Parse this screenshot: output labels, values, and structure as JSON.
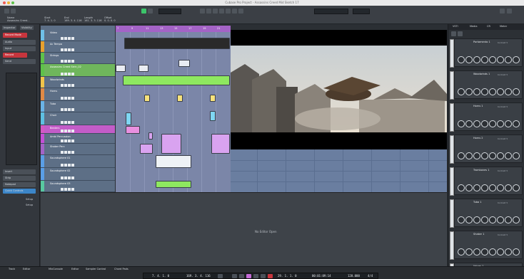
{
  "window": {
    "title": "Cubase Pro Project - Assassins Creed Mid Sketch 17"
  },
  "colors": {
    "accent_purple": "#a463c7",
    "accent_green": "#5fc24a",
    "record_red": "#c7353d",
    "arrange_bg": "#7b86a8"
  },
  "toolbar": {
    "fields": [
      {
        "label": "Name",
        "value": "Assassins Creed..."
      },
      {
        "label": "Start",
        "value": "7. 4. 1. 0"
      },
      {
        "label": "End",
        "value": "169. 3. 4. 116"
      },
      {
        "label": "Length",
        "value": "161. 3. 3. 116"
      },
      {
        "label": "Offset",
        "value": "0. 0. 0. 0"
      }
    ],
    "tool_icons": [
      "select-icon",
      "range-icon",
      "split-icon",
      "glue-icon",
      "erase-icon",
      "zoom-icon",
      "mute-icon",
      "draw-icon",
      "line-icon",
      "play-icon"
    ]
  },
  "left_panel": {
    "tabs": [
      "Inspector",
      "Visibility"
    ],
    "record_rows": [
      "Record Mode",
      "Record"
    ],
    "rows": [
      "Audio",
      "Input",
      "Send",
      "Insert",
      "Strip",
      "Notepad",
      "Quick Controls"
    ],
    "groups": [
      "Setup",
      "Setup"
    ]
  },
  "tracks": [
    {
      "name": "Video",
      "color": "#6fc0e8"
    },
    {
      "name": "Ac Tempo",
      "color": "#e8a12e"
    },
    {
      "name": "Strings",
      "color": "#5fc24a"
    },
    {
      "name": "Assassins Creed Strin_02",
      "color": "#5fc24a"
    },
    {
      "name": "Woodwinds",
      "color": "#f1c44a"
    },
    {
      "name": "Horns",
      "color": "#e08a46"
    },
    {
      "name": "Tuba",
      "color": "#6ab3e6"
    },
    {
      "name": "Choir",
      "color": "#5ec0e2"
    },
    {
      "name": "Beaters",
      "color": "#d459c4"
    },
    {
      "name": "Ambi Percussion",
      "color": "#c44fd6"
    },
    {
      "name": "Shaker Perc",
      "color": "#a463c7"
    },
    {
      "name": "Soundsphere 01",
      "color": "#5a9ee6"
    },
    {
      "name": "Soundsphere 02",
      "color": "#5a9ee6"
    },
    {
      "name": "Soundsphere 03",
      "color": "#58c8a0"
    }
  ],
  "ruler": {
    "marks": [
      "7",
      "9",
      "11",
      "13",
      "15",
      "17",
      "19",
      "21"
    ]
  },
  "lower_zone": {
    "placeholder": "No Editor Open"
  },
  "right_panel": {
    "tabs": [
      "VSTi",
      "Media",
      "CR",
      "Meter"
    ],
    "racks": [
      {
        "name": "Portamento 1",
        "preset": "Kontakt 5"
      },
      {
        "name": "Woodwinds 1",
        "preset": "Kontakt 5"
      },
      {
        "name": "Horns 1",
        "preset": "Kontakt 5"
      },
      {
        "name": "Horns 2",
        "preset": "Kontakt 5"
      },
      {
        "name": "Trombones 1",
        "preset": "Kontakt 5"
      },
      {
        "name": "Tuba 1",
        "preset": "Kontakt 5"
      },
      {
        "name": "Shaker 1",
        "preset": "Kontakt 5"
      },
      {
        "name": "Voices 1",
        "preset": "Kontakt 5"
      }
    ]
  },
  "bottom": {
    "tabs": [
      "Track",
      "Editor",
      "MixConsole",
      "Editor",
      "Sampler Control",
      "Chord Pads"
    ],
    "transport": {
      "left_locator": "7. 4. 1. 0",
      "right_locator": "169. 3. 4. 116",
      "position": "29. 1. 1. 0",
      "time": "00:01:09:14",
      "tempo": "120.000",
      "signature": "4/4"
    }
  }
}
